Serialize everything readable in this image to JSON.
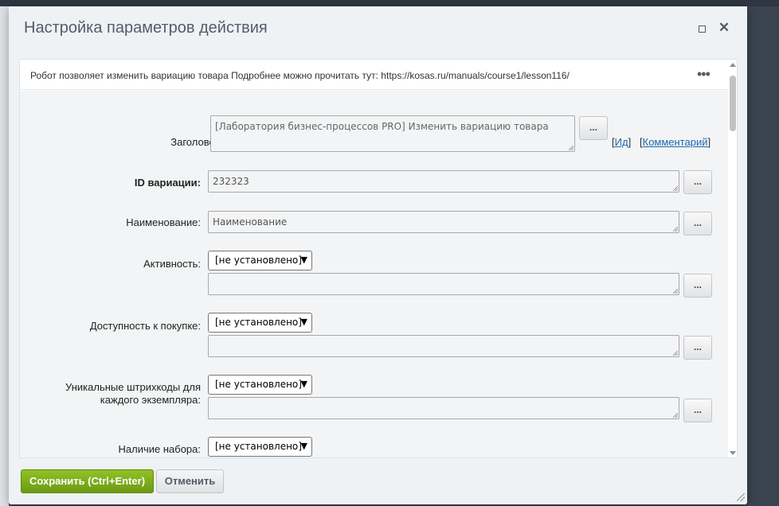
{
  "dialog": {
    "title": "Настройка параметров действия",
    "maximize_icon": "maximize-icon",
    "close_icon": "close-icon",
    "close_glyph": "✕"
  },
  "info": {
    "text": "Робот позволяет изменить вариацию товара Подробнее можно прочитать тут: https://kosas.ru/manuals/course1/lesson116/",
    "more_glyph": "•••"
  },
  "fields": {
    "title": {
      "label": "Заголовок:",
      "value": "[Лаборатория бизнес-процессов PRO] Изменить вариацию товара",
      "dots": "...",
      "id_link": "Ид",
      "comment_link": "Комментарий"
    },
    "variation_id": {
      "label": "ID вариации:",
      "value": "232323",
      "dots": "..."
    },
    "name": {
      "label": "Наименование:",
      "value": "Наименование",
      "dots": "..."
    },
    "active": {
      "label": "Активность:",
      "select": "[не установлено]",
      "value": "",
      "dots": "..."
    },
    "availability": {
      "label": "Доступность к покупке:",
      "select": "[не установлено]",
      "value": "",
      "dots": "..."
    },
    "barcodes": {
      "label_line1": "Уникальные штрихкоды для",
      "label_line2": "каждого экземпляра:",
      "select": "[не установлено]",
      "value": "",
      "dots": "..."
    },
    "bundle": {
      "label": "Наличие набора:",
      "select": "[не установлено]"
    }
  },
  "footer": {
    "save_label": "Сохранить (Ctrl+Enter)",
    "cancel_label": "Отменить"
  },
  "colors": {
    "save_green": "#7bab1a",
    "link_blue": "#2067b0"
  }
}
